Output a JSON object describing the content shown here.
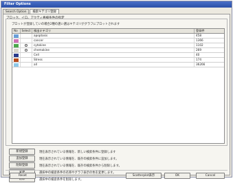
{
  "window": {
    "title": "Filter Options"
  },
  "tabs": [
    {
      "label": "Search Option",
      "active": false
    },
    {
      "label": "検索キテゴリ登録",
      "active": true
    }
  ],
  "group": {
    "title": "ブロック、イロ、アクティ格検条件の指定",
    "description": "プロットが登録していの場合2種の選い選はキテゴリがグラフにプロットされます"
  },
  "grid": {
    "headers": [
      "No",
      "Select",
      "検出キテゴリ",
      "登録件"
    ],
    "rows": [
      {
        "no": "1",
        "color": "#6a9fd8",
        "selected": "",
        "name": "apoptosis",
        "count": "458"
      },
      {
        "no": "2",
        "color": "#d070b8",
        "selected": "",
        "name": "cancer",
        "count": "1366"
      },
      {
        "no": "3",
        "color": "#4ca84c",
        "selected": "radio",
        "name": "cytokine",
        "count": "1102"
      },
      {
        "no": "4",
        "color": "#d8d4c8",
        "selected": "radio",
        "name": "chemokine",
        "count": "269"
      },
      {
        "no": "5",
        "color": "#2a3a8a",
        "selected": "",
        "name": "Cell",
        "count": "40"
      },
      {
        "no": "6",
        "color": "#b84a1a",
        "selected": "",
        "name": "Stress",
        "count": "174"
      },
      {
        "no": "7",
        "color": "#8cc8e8",
        "selected": "",
        "name": "all",
        "count": "36266"
      }
    ]
  },
  "actions": [
    {
      "label": "新規登録",
      "text": "現在表示されている情報を、新しい検索条件に登録します"
    },
    {
      "label": "追加登録",
      "text": "現在表示されている情報を、既存の検索条件に追加します。"
    },
    {
      "label": "削除登録",
      "text": "現在表示されている情報を、既存の検索条件から削除します。"
    },
    {
      "label": "変更",
      "text": "選択中の検索条件の名称やグラフ表示の色を変更します。"
    },
    {
      "label": "削除",
      "text": "選択中の検索条件を削除します。"
    }
  ],
  "footer": {
    "reset": "Reset",
    "scatter": "Scatterplot表示",
    "ok": "OK",
    "cancel": "Cancel"
  }
}
